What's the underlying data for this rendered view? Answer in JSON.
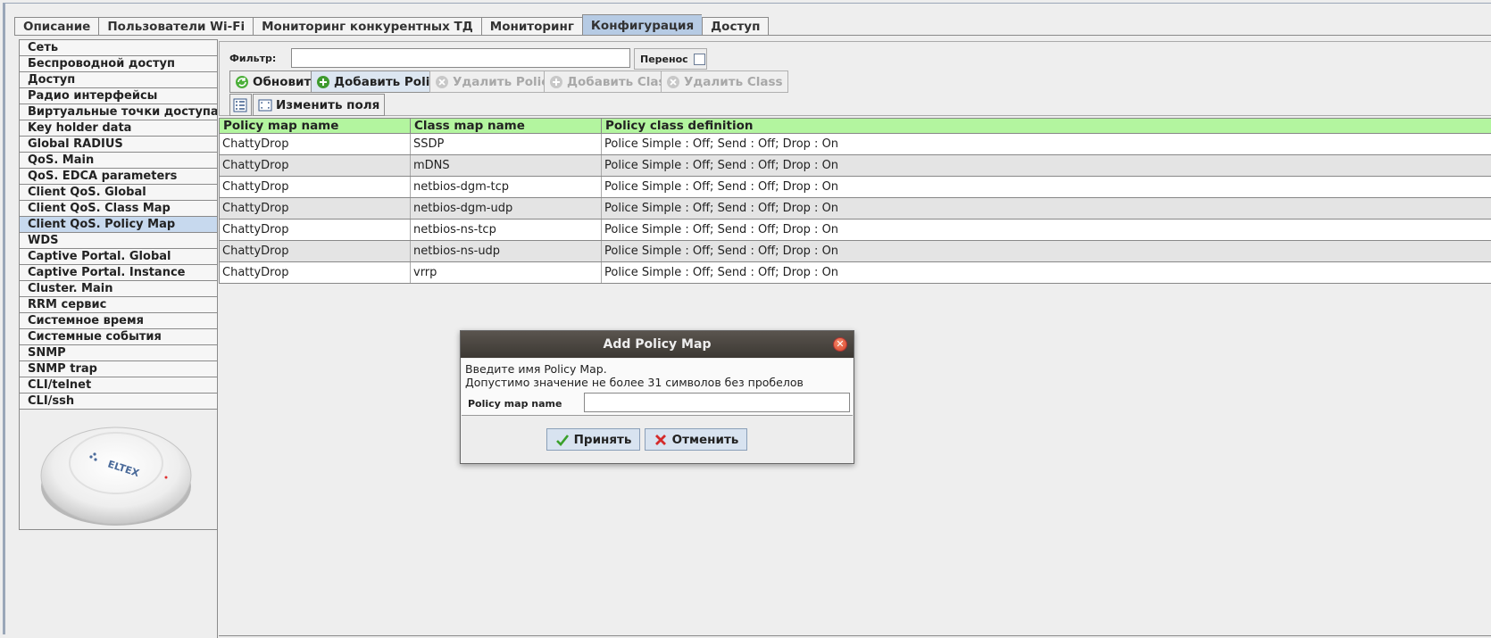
{
  "tabs": [
    {
      "label": "Описание",
      "active": false
    },
    {
      "label": "Пользователи Wi-Fi",
      "active": false
    },
    {
      "label": "Мониторинг конкурентных ТД",
      "active": false
    },
    {
      "label": "Мониторинг",
      "active": false
    },
    {
      "label": "Конфигурация",
      "active": true
    },
    {
      "label": "Доступ",
      "active": false
    }
  ],
  "sidebar": {
    "items": [
      "Сеть",
      "Беспроводной доступ",
      "Доступ",
      "Радио интерфейсы",
      "Виртуальные точки доступа",
      "Key holder data",
      "Global RADIUS",
      "QoS. Main",
      "QoS. EDCA parameters",
      "Client QoS. Global",
      "Client QoS. Class Map",
      "Client QoS. Policy Map",
      "WDS",
      "Captive Portal. Global",
      "Captive Portal. Instance",
      "Cluster. Main",
      "RRM сервис",
      "Системное время",
      "Системные события",
      "SNMP",
      "SNMP trap",
      "CLI/telnet",
      "CLI/ssh"
    ],
    "selected_index": 11,
    "device_logo": "ELTEX"
  },
  "toolbar": {
    "filter_label": "Фильтр:",
    "filter_value": "",
    "wrap_label": "Перенос",
    "refresh_label": "Обновить",
    "add_policy_label": "Добавить Policy",
    "delete_policy_label": "Удалить Policy",
    "add_class_label": "Добавить Class",
    "delete_class_label": "Удалить Class",
    "edit_fields_label": "Изменить поля"
  },
  "table": {
    "columns": [
      "Policy map name",
      "Class map name",
      "Policy class definition"
    ],
    "rows": [
      [
        "ChattyDrop",
        "SSDP",
        "Police Simple : Off; Send : Off; Drop : On"
      ],
      [
        "ChattyDrop",
        "mDNS",
        "Police Simple : Off; Send : Off; Drop : On"
      ],
      [
        "ChattyDrop",
        "netbios-dgm-tcp",
        "Police Simple : Off; Send : Off; Drop : On"
      ],
      [
        "ChattyDrop",
        "netbios-dgm-udp",
        "Police Simple : Off; Send : Off; Drop : On"
      ],
      [
        "ChattyDrop",
        "netbios-ns-tcp",
        "Police Simple : Off; Send : Off; Drop : On"
      ],
      [
        "ChattyDrop",
        "netbios-ns-udp",
        "Police Simple : Off; Send : Off; Drop : On"
      ],
      [
        "ChattyDrop",
        "vrrp",
        "Police Simple : Off; Send : Off; Drop : On"
      ]
    ]
  },
  "dialog": {
    "title": "Add Policy Map",
    "line1": "Введите имя Policy Map.",
    "line2": "Допустимо значение не более 31 символов без пробелов",
    "field_label": "Policy map name",
    "field_value": "",
    "ok_label": "Принять",
    "cancel_label": "Отменить"
  },
  "colors": {
    "header_green": "#b3f59f",
    "active_tab": "#b6cbe4",
    "dialog_title": "#3c3833",
    "close_red": "#d6432a"
  }
}
